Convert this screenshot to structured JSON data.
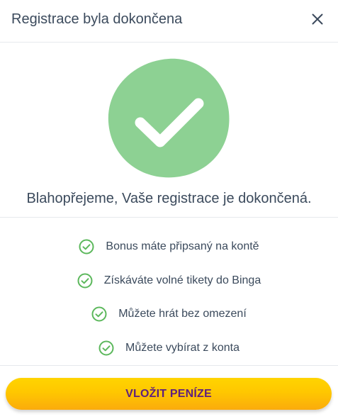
{
  "modal": {
    "title": "Registrace byla dokončena",
    "close_icon": "close-icon"
  },
  "hero": {
    "icon": "checkmark-icon",
    "headline": "Blahopřejeme, Vaše registrace je dokončená."
  },
  "benefits": [
    {
      "icon": "circle-check-icon",
      "label": "Bonus máte připsaný na kontě"
    },
    {
      "icon": "circle-check-icon",
      "label": "Získáváte volné tikety do Binga"
    },
    {
      "icon": "circle-check-icon",
      "label": "Můžete hrát bez omezení"
    },
    {
      "icon": "circle-check-icon",
      "label": "Můžete vybírat z konta"
    }
  ],
  "cta": {
    "label": "VLOŽIT PENÍZE"
  },
  "colors": {
    "success_green": "#8dd193",
    "check_green": "#5cb85c",
    "button_yellow": "#ffc700",
    "button_text_purple": "#5e1f7e",
    "text_dark": "#3b4a5c"
  }
}
